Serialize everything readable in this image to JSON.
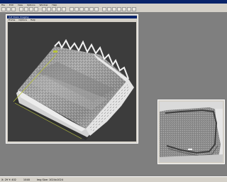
{
  "app": {
    "menus": [
      "File",
      "Edit",
      "View",
      "Options",
      "Window",
      "Help"
    ]
  },
  "window3d": {
    "title": "3-D Vision Imaging",
    "menus": [
      "Frame",
      "Options",
      "Help"
    ]
  },
  "statusbar": {
    "coords": "X: 29    Y: 402",
    "value": "1048",
    "info": "Img Size: 1024x1024"
  },
  "colors": {
    "titlebar": "#0a246a",
    "chrome": "#d4d0c8",
    "desktop": "#7f7f7f",
    "viewport": "#3c3c3c"
  }
}
